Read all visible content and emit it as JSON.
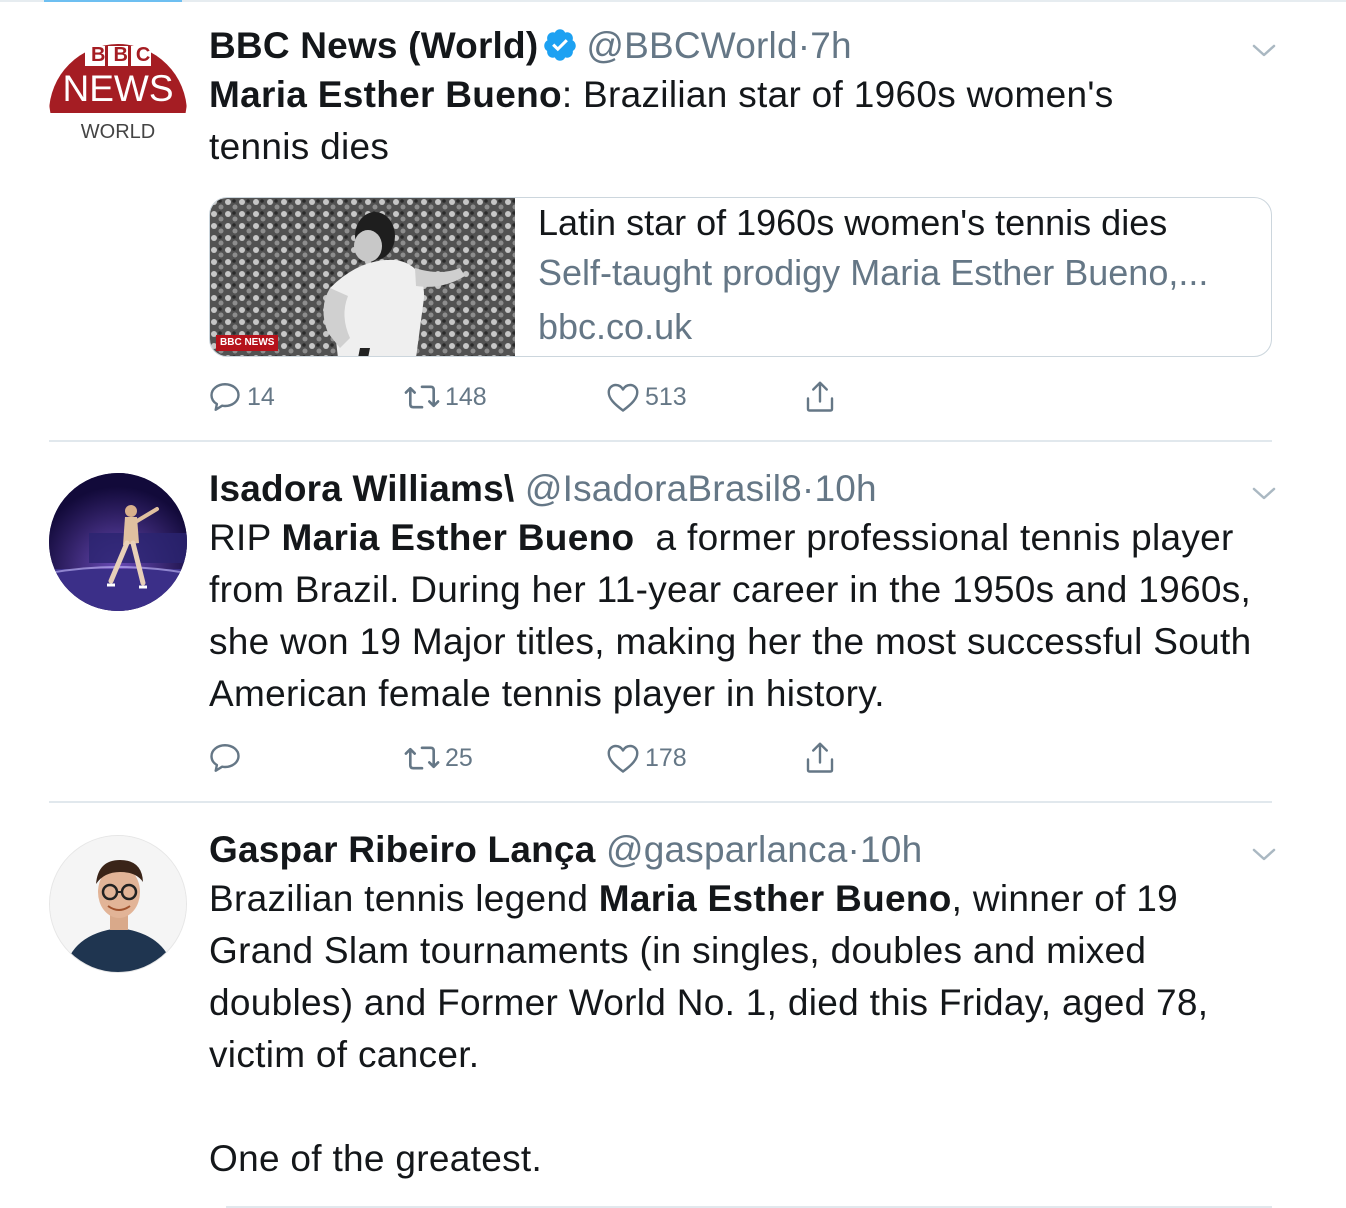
{
  "tweets": [
    {
      "author_name": "BBC News (World)",
      "verified": true,
      "handle": "@BBCWorld",
      "separator": "·",
      "time": "7h",
      "avatar": {
        "logo_top": "BBC",
        "logo_mid": "NEWS",
        "logo_bottom": "WORLD"
      },
      "text_bold": "Maria Esther Bueno",
      "text_rest": ": Brazilian star of 1960s women's tennis dies",
      "card": {
        "title": "Latin star of 1960s women's tennis dies",
        "description": "Self-taught prodigy Maria Esther Bueno,...",
        "domain": "bbc.co.uk",
        "image_badge": "BBC NEWS"
      },
      "replies": "14",
      "retweets": "148",
      "likes": "513"
    },
    {
      "author_name": "Isadora Williams\\",
      "handle": "@IsadoraBrasil8",
      "separator": "·",
      "time": "10h",
      "text_prefix": "RIP ",
      "text_bold": "Maria Esther Bueno",
      "text_rest": "  a former professional tennis player from Brazil. During her 11-year career in the 1950s and 1960s, she won 19 Major titles, making her the most successful South American female tennis player in history.",
      "replies": "",
      "retweets": "25",
      "likes": "178"
    },
    {
      "author_name": "Gaspar Ribeiro Lança",
      "handle": "@gasparlanca",
      "separator": "·",
      "time": "10h",
      "text_prefix": "Brazilian tennis legend ",
      "text_bold": "Maria Esther Bueno",
      "text_rest": ", winner of 19 Grand Slam tournaments (in singles, doubles and mixed doubles) and Former World No. 1, died this Friday, aged 78, victim of cancer.",
      "text_last": "One of the greatest."
    }
  ],
  "colors": {
    "bbc_red": "#a51d23",
    "secondary_text": "#657786",
    "verified_blue": "#1da1f2"
  }
}
